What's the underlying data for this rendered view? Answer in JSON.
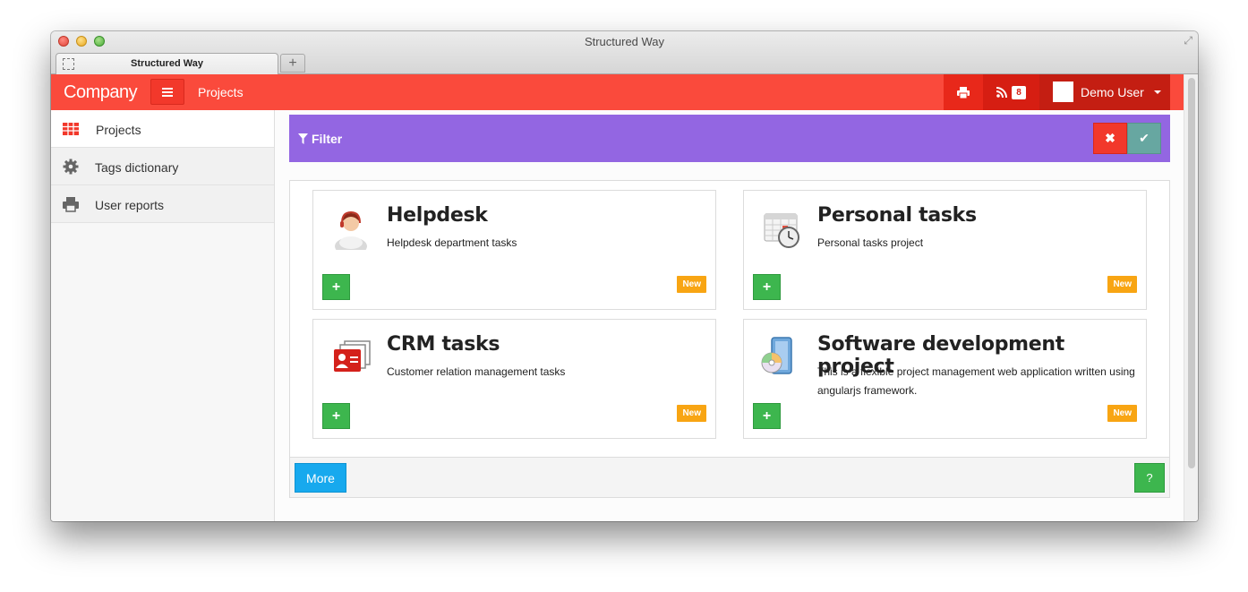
{
  "window": {
    "title": "Structured Way"
  },
  "tab": {
    "label": "Structured Way",
    "new_tab_symbol": "+"
  },
  "navbar": {
    "brand": "Company",
    "menu_icon": "hamburger-icon",
    "link": "Projects",
    "print_icon": "print-icon",
    "rss_icon": "rss-icon",
    "notification_count": "8",
    "user_name": "Demo User",
    "accent_color": "#fa4a3c"
  },
  "sidebar": {
    "items": [
      {
        "label": "Projects",
        "icon": "table-icon",
        "active": true
      },
      {
        "label": "Tags dictionary",
        "icon": "gear-icon",
        "active": false
      },
      {
        "label": "User reports",
        "icon": "print-icon",
        "active": false
      }
    ]
  },
  "filter": {
    "label": "Filter",
    "color": "#9366e2"
  },
  "projects": [
    {
      "title": "Helpdesk",
      "description": "Helpdesk department tasks",
      "badge": "New",
      "icon": "support-agent-icon"
    },
    {
      "title": "Personal tasks",
      "description": "Personal tasks project",
      "badge": "New",
      "icon": "calendar-clock-icon"
    },
    {
      "title": "CRM tasks",
      "description": "Customer relation management tasks",
      "badge": "New",
      "icon": "contact-cards-icon"
    },
    {
      "title": "Software development project",
      "description": "This is a flexible project management web application written using angularjs framework.",
      "badge": "New",
      "icon": "software-install-icon"
    }
  ],
  "footer": {
    "more_label": "More",
    "help_label": "?"
  }
}
